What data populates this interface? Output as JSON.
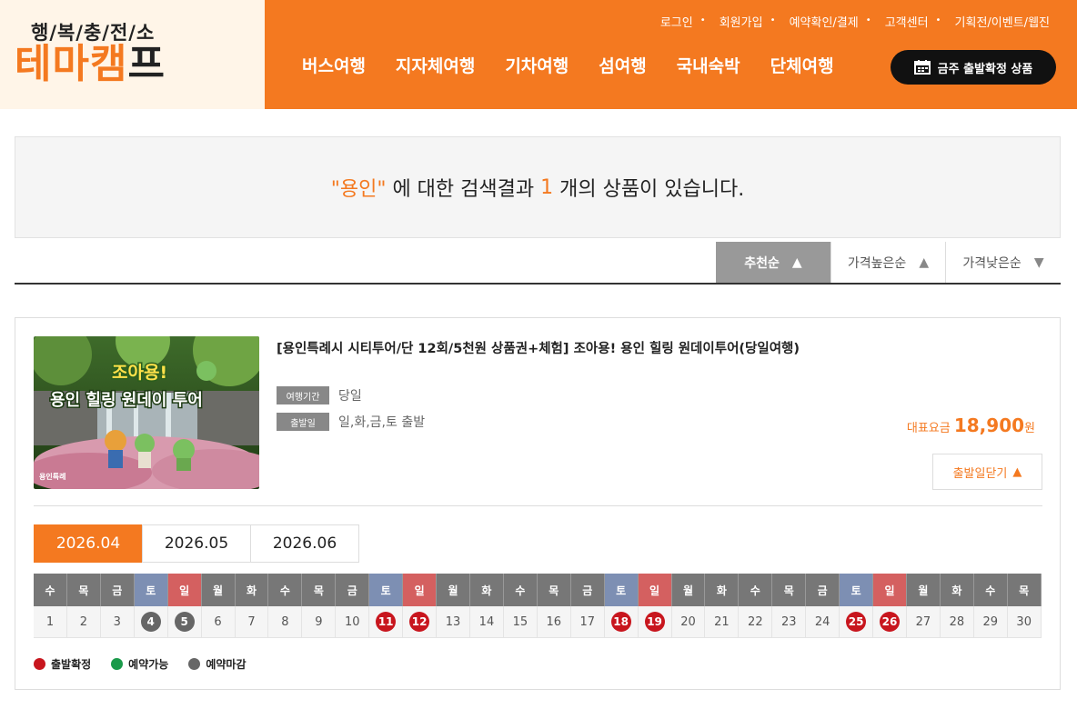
{
  "header": {
    "logo_sub": "행/복/충/전/소",
    "logo_main_part1": "테마",
    "logo_main_part2": "캠",
    "logo_main_part3": "프",
    "util_links": [
      "로그인",
      "회원가입",
      "예약확인/결제",
      "고객센터",
      "기획전/이벤트/웹진"
    ],
    "nav": [
      "버스여행",
      "지자체여행",
      "기차여행",
      "섬여행",
      "국내숙박",
      "단체여행"
    ],
    "weekly_button": "금주 출발확정 상품",
    "colors": {
      "accent": "#f47920",
      "logo_bg": "#fff5e8"
    }
  },
  "search": {
    "keyword": "\"용인\"",
    "text_middle": " 에 대한 검색결과 ",
    "count": "1",
    "text_end": " 개의 상품이 있습니다."
  },
  "sort": [
    {
      "label": "추천순",
      "arrow": "▲",
      "active": true
    },
    {
      "label": "가격높은순",
      "arrow": "▲",
      "active": false
    },
    {
      "label": "가격낮은순",
      "arrow": "▼",
      "active": false
    }
  ],
  "product": {
    "title": "[용인특례시 시티투어/단 12회/5천원 상품권+체험] 조아용! 용인 힐링 원데이투어(당일여행)",
    "thumb_text1": "조아용!",
    "thumb_text2": "용인 힐링 원데이 투어",
    "thumb_logo": "용인특례",
    "period_label": "여행기간",
    "period_value": "당일",
    "depart_label": "출발일",
    "depart_value": "일,화,금,토 출발",
    "price_label": "대표요금",
    "price_value": "18,900",
    "price_unit": "원",
    "toggle_label": "출발일닫기",
    "toggle_arrow": "▲"
  },
  "calendar": {
    "months": [
      "2026.04",
      "2026.05",
      "2026.06"
    ],
    "active_month": 0,
    "days": [
      {
        "d": "1",
        "w": "수",
        "s": ""
      },
      {
        "d": "2",
        "w": "목",
        "s": ""
      },
      {
        "d": "3",
        "w": "금",
        "s": ""
      },
      {
        "d": "4",
        "w": "토",
        "s": "closed"
      },
      {
        "d": "5",
        "w": "일",
        "s": "closed"
      },
      {
        "d": "6",
        "w": "월",
        "s": ""
      },
      {
        "d": "7",
        "w": "화",
        "s": ""
      },
      {
        "d": "8",
        "w": "수",
        "s": ""
      },
      {
        "d": "9",
        "w": "목",
        "s": ""
      },
      {
        "d": "10",
        "w": "금",
        "s": ""
      },
      {
        "d": "11",
        "w": "토",
        "s": "confirmed"
      },
      {
        "d": "12",
        "w": "일",
        "s": "confirmed"
      },
      {
        "d": "13",
        "w": "월",
        "s": ""
      },
      {
        "d": "14",
        "w": "화",
        "s": ""
      },
      {
        "d": "15",
        "w": "수",
        "s": ""
      },
      {
        "d": "16",
        "w": "목",
        "s": ""
      },
      {
        "d": "17",
        "w": "금",
        "s": ""
      },
      {
        "d": "18",
        "w": "토",
        "s": "confirmed"
      },
      {
        "d": "19",
        "w": "일",
        "s": "confirmed"
      },
      {
        "d": "20",
        "w": "월",
        "s": ""
      },
      {
        "d": "21",
        "w": "화",
        "s": ""
      },
      {
        "d": "22",
        "w": "수",
        "s": ""
      },
      {
        "d": "23",
        "w": "목",
        "s": ""
      },
      {
        "d": "24",
        "w": "금",
        "s": ""
      },
      {
        "d": "25",
        "w": "토",
        "s": "confirmed"
      },
      {
        "d": "26",
        "w": "일",
        "s": "confirmed"
      },
      {
        "d": "27",
        "w": "월",
        "s": ""
      },
      {
        "d": "28",
        "w": "화",
        "s": ""
      },
      {
        "d": "29",
        "w": "수",
        "s": ""
      },
      {
        "d": "30",
        "w": "목",
        "s": ""
      }
    ],
    "legend": [
      {
        "label": "출발확정",
        "color": "#c8161e"
      },
      {
        "label": "예약가능",
        "color": "#1a9a4a"
      },
      {
        "label": "예약마감",
        "color": "#666666"
      }
    ]
  }
}
